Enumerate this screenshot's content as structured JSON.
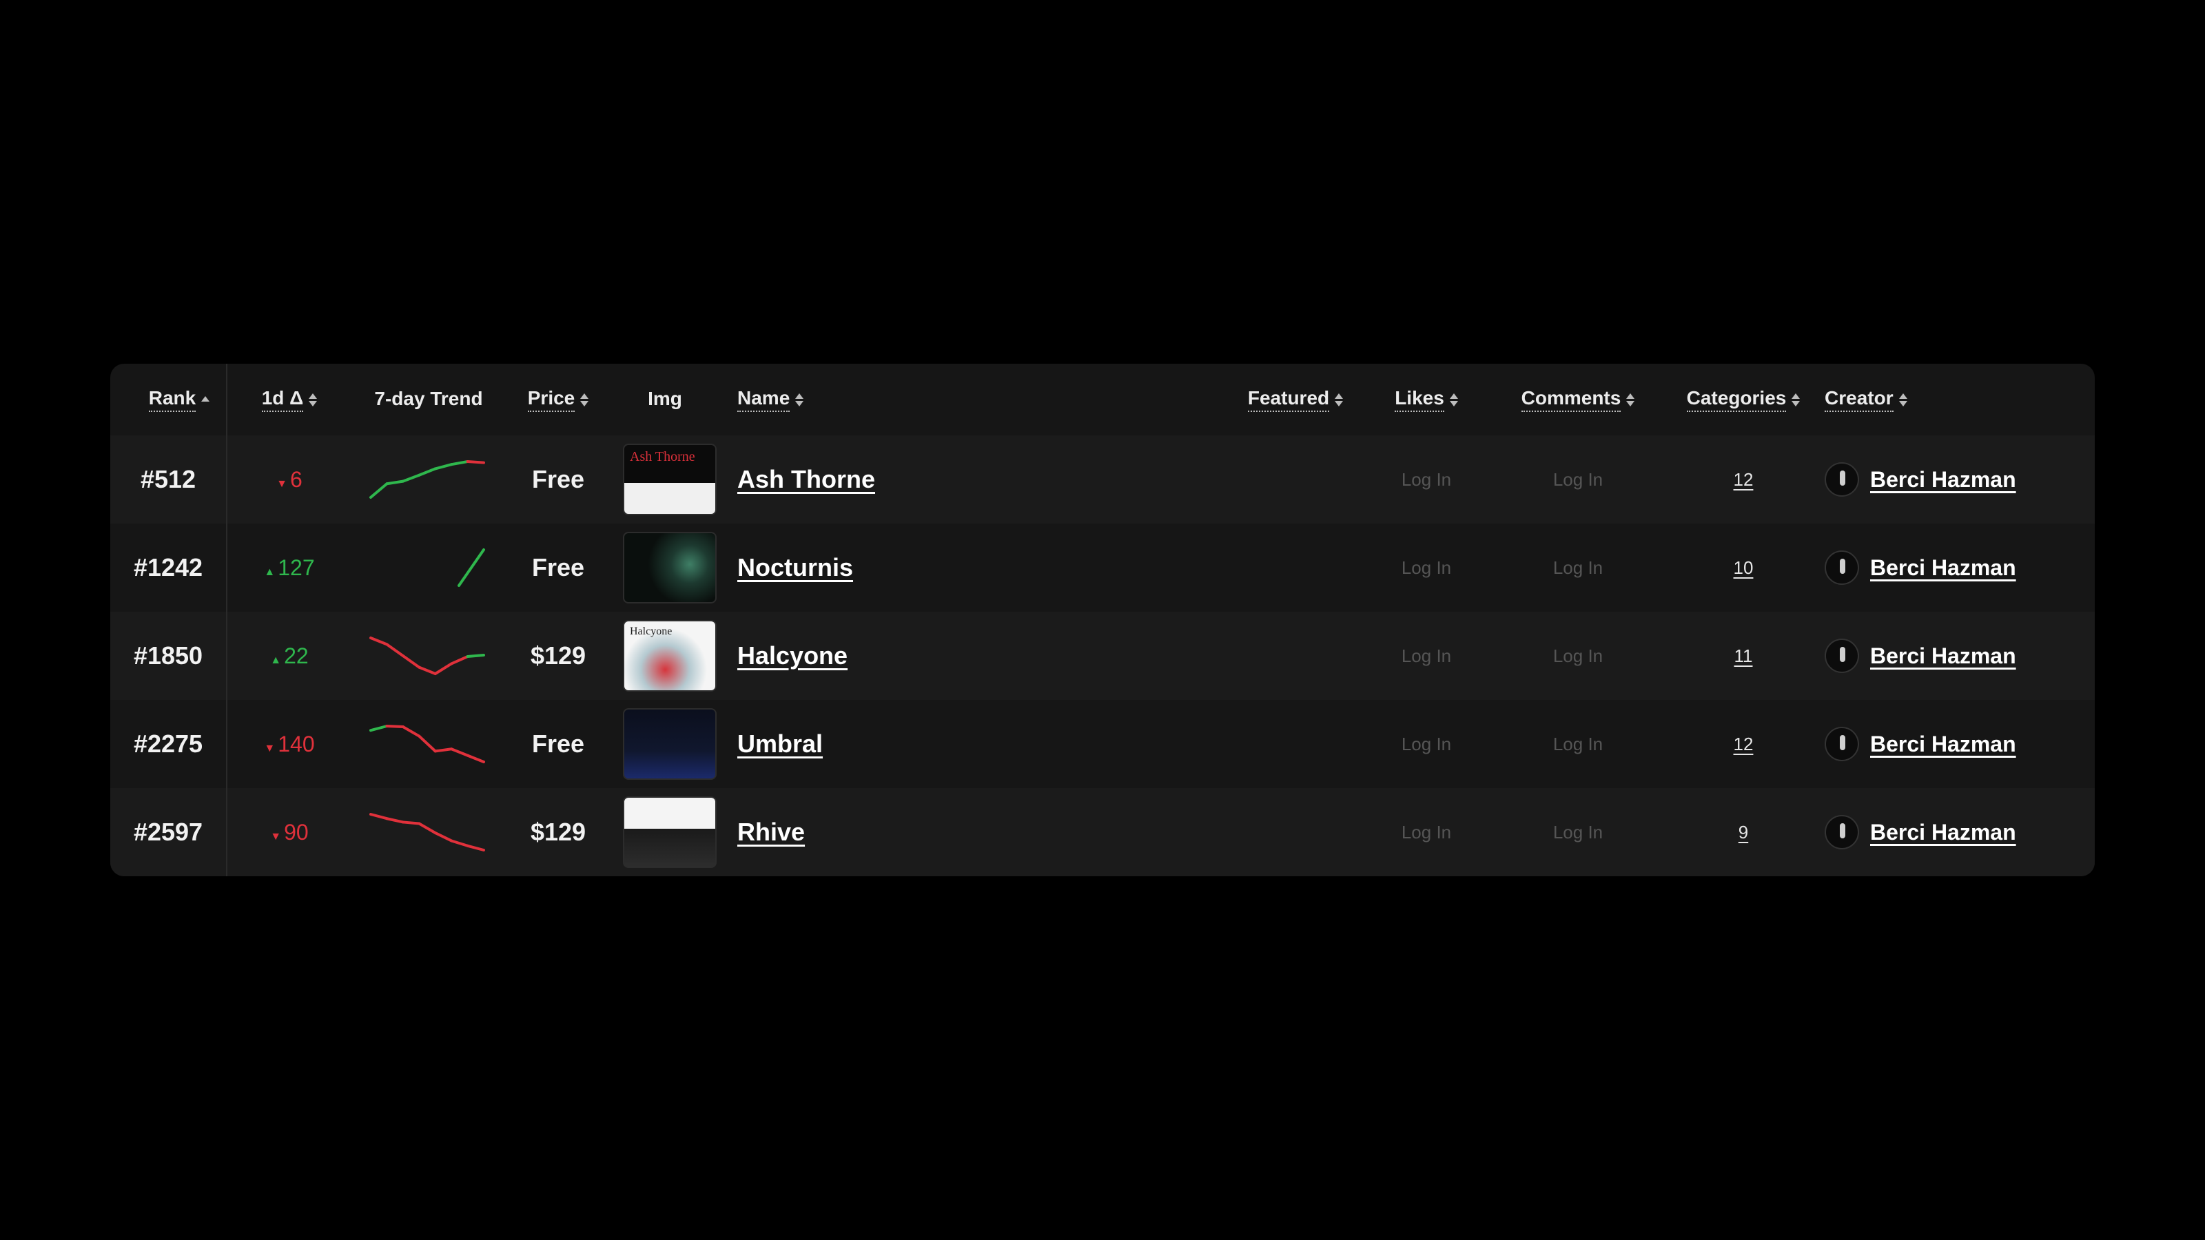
{
  "columns": {
    "rank": "Rank",
    "delta": "1d Δ",
    "trend": "7-day Trend",
    "price": "Price",
    "img": "Img",
    "name": "Name",
    "featured": "Featured",
    "likes": "Likes",
    "comments": "Comments",
    "categories": "Categories",
    "creator": "Creator"
  },
  "rows": [
    {
      "rank": "#512",
      "delta": "6",
      "delta_dir": "down",
      "trend": [
        0.0,
        0.38,
        0.45,
        0.62,
        0.8,
        0.92,
        1.0,
        0.97
      ],
      "trend_color": "#2fb74d",
      "trend_tail_color": "#e0313b",
      "price": "Free",
      "thumb_text": "Ash Thorne",
      "name": "Ash Thorne",
      "likes": "Log In",
      "comments": "Log In",
      "categories": "12",
      "creator": "Berci Hazman"
    },
    {
      "rank": "#1242",
      "delta": "127",
      "delta_dir": "up",
      "trend": [
        0.0,
        1.0
      ],
      "trend_color": "#2fb74d",
      "price": "Free",
      "thumb_text": "",
      "name": "Nocturnis",
      "likes": "Log In",
      "comments": "Log In",
      "categories": "10",
      "creator": "Berci Hazman"
    },
    {
      "rank": "#1850",
      "delta": "22",
      "delta_dir": "up",
      "trend": [
        1.0,
        0.82,
        0.5,
        0.18,
        0.0,
        0.28,
        0.48,
        0.52
      ],
      "trend_color": "#e0313b",
      "trend_tail_color": "#2fb74d",
      "price": "$129",
      "thumb_text": "Halcyone",
      "name": "Halcyone",
      "likes": "Log In",
      "comments": "Log In",
      "categories": "11",
      "creator": "Berci Hazman"
    },
    {
      "rank": "#2275",
      "delta": "140",
      "delta_dir": "down",
      "trend": [
        0.88,
        1.0,
        0.98,
        0.72,
        0.3,
        0.36,
        0.18,
        0.0
      ],
      "trend_color": "#e0313b",
      "trend_head_color": "#2fb74d",
      "price": "Free",
      "thumb_text": "",
      "name": "Umbral",
      "likes": "Log In",
      "comments": "Log In",
      "categories": "12",
      "creator": "Berci Hazman"
    },
    {
      "rank": "#2597",
      "delta": "90",
      "delta_dir": "down",
      "trend": [
        1.0,
        0.88,
        0.78,
        0.74,
        0.48,
        0.26,
        0.12,
        0.0
      ],
      "trend_color": "#e0313b",
      "price": "$129",
      "thumb_text": "",
      "name": "Rhive",
      "likes": "Log In",
      "comments": "Log In",
      "categories": "9",
      "creator": "Berci Hazman"
    }
  ],
  "colors": {
    "up": "#2fb74d",
    "down": "#e0313b",
    "panel": "#161616",
    "row_alt": "#1b1b1b"
  }
}
